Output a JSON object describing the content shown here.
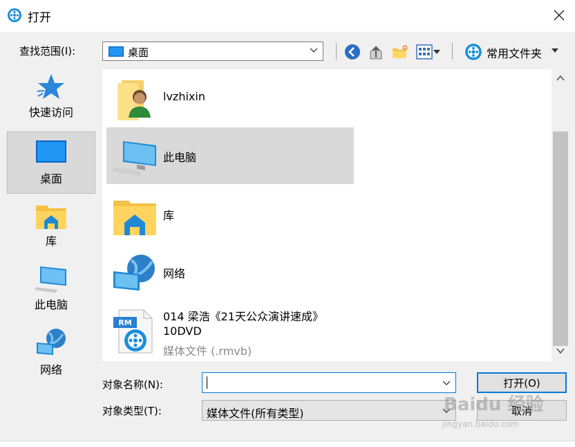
{
  "window": {
    "title": "打开"
  },
  "toolbar": {
    "lookin_label": "查找范围(I):",
    "lookin_value": "桌面",
    "favorites_label": "常用文件夹"
  },
  "places": [
    {
      "label": "快速访问",
      "icon": "star-icon"
    },
    {
      "label": "桌面",
      "icon": "desktop-icon",
      "selected": true
    },
    {
      "label": "库",
      "icon": "library-icon"
    },
    {
      "label": "此电脑",
      "icon": "computer-icon"
    },
    {
      "label": "网络",
      "icon": "network-icon"
    }
  ],
  "files": [
    {
      "name": "lvzhixin",
      "icon": "user-folder-icon"
    },
    {
      "name": "此电脑",
      "icon": "computer-icon",
      "selected": true
    },
    {
      "name": "库",
      "icon": "library-icon"
    },
    {
      "name": "网络",
      "icon": "network-icon"
    },
    {
      "name_line1": "014 梁浩《21天公众演讲速成》",
      "name_line2": "10DVD",
      "type": "媒体文件 (.rmvb)",
      "icon": "rmvb-file-icon",
      "badge": "RM"
    }
  ],
  "footer": {
    "filename_label": "对象名称(N):",
    "filename_value": "",
    "filetype_label": "对象类型(T):",
    "filetype_value": "媒体文件(所有类型)",
    "open_button": "打开(O)",
    "cancel_button": "取消"
  },
  "watermark": {
    "brand": "Baidu 经验",
    "url": "jingyan.baidu.com"
  },
  "colors": {
    "accent": "#0078d7",
    "selection": "#d9d9d9",
    "background": "#f0f0f0"
  }
}
